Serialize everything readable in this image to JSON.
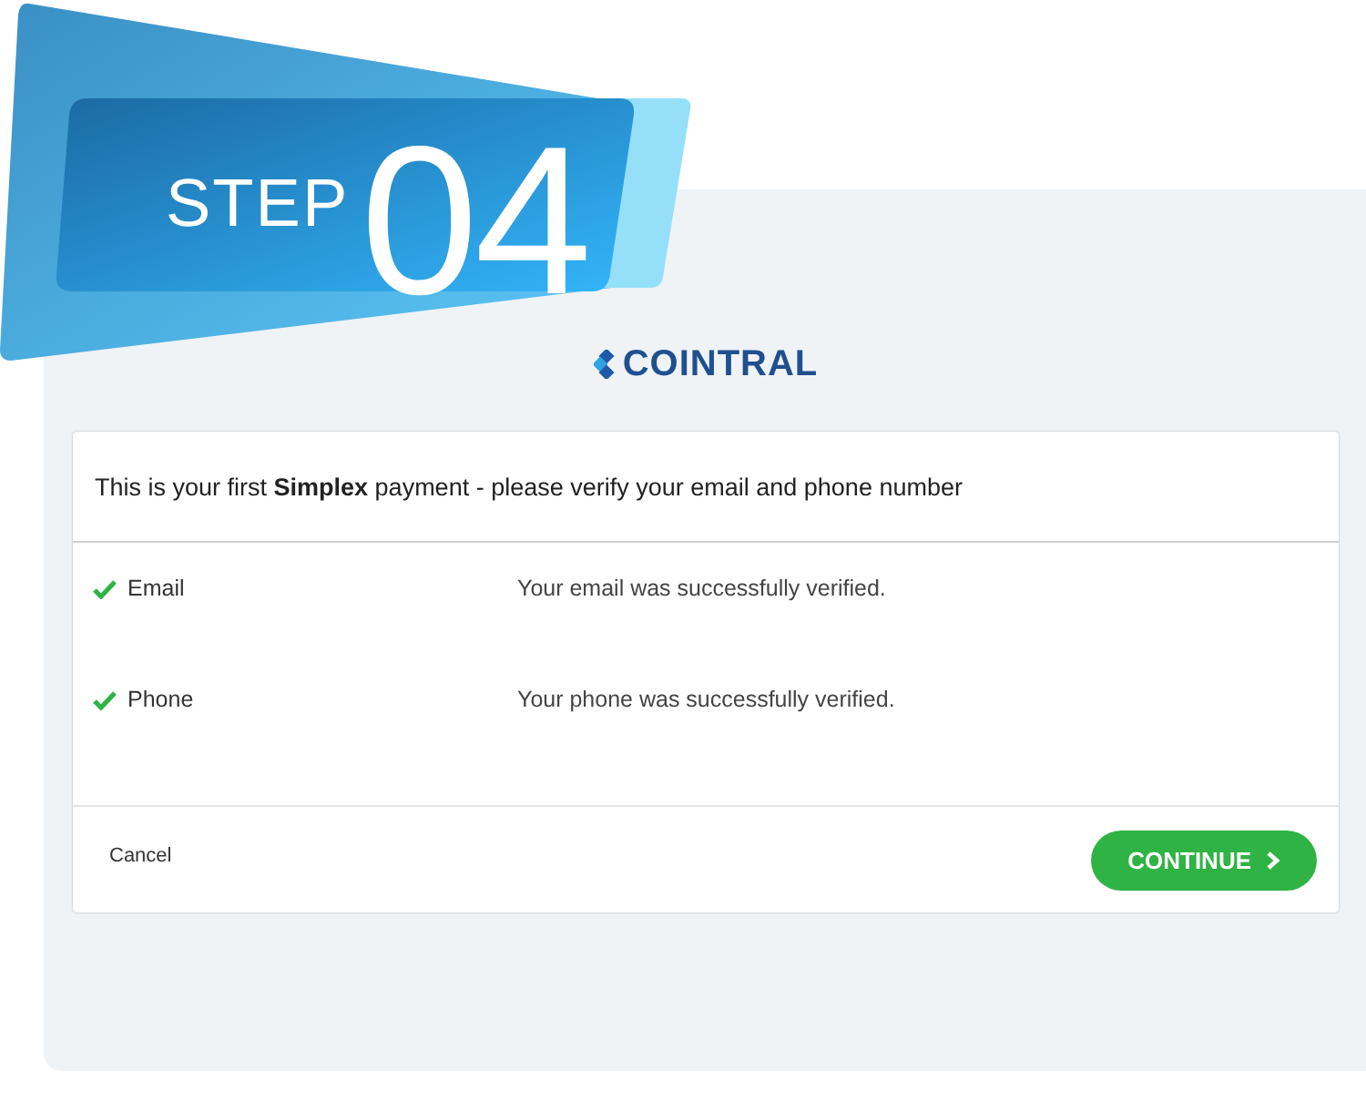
{
  "banner": {
    "label": "STEP",
    "number": "04"
  },
  "brand": {
    "name": "COINTRAL"
  },
  "dialog": {
    "title": "This is your first **Simplex** payment - please verify your email and phone number",
    "rows": [
      {
        "label": "Email",
        "verified": true,
        "message": "Your email was successfully verified."
      },
      {
        "label": "Phone",
        "verified": true,
        "message": "Your phone was successfully verified."
      }
    ],
    "cancel": "Cancel",
    "continue": "CONTINUE"
  }
}
